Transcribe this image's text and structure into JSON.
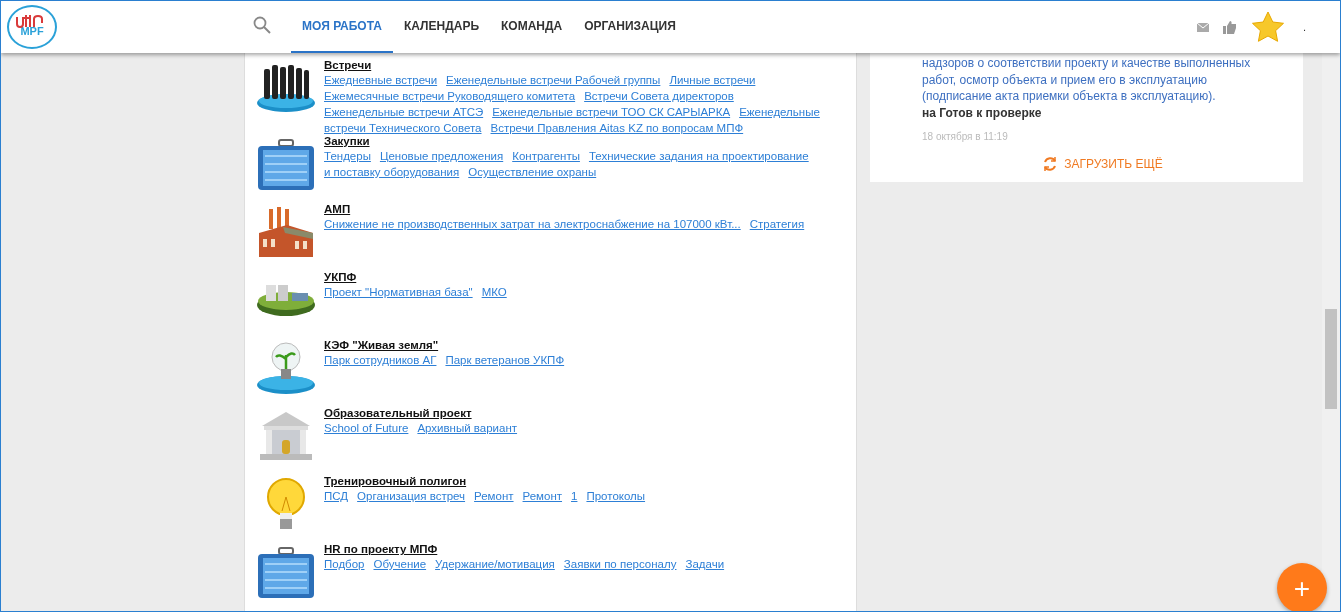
{
  "header": {
    "logo": "MPF",
    "tabs": [
      {
        "label": "МОЯ РАБОТА",
        "selected": true
      },
      {
        "label": "КАЛЕНДАРЬ",
        "selected": false
      },
      {
        "label": "КОМАНДА",
        "selected": false
      },
      {
        "label": "ОРГАНИЗАЦИЯ",
        "selected": false
      }
    ],
    "user_name": "."
  },
  "sections": [
    {
      "title": "Встречи",
      "lines": [
        [
          "Ежедневные встречи",
          "Еженедельные встречи Рабочей группы",
          "Личные встречи"
        ],
        [
          "Ежемесячные встречи Руководящего комитета",
          "Встречи Совета директоров"
        ],
        [
          "Еженедельные встречи АТСЭ",
          "Еженедельные встречи ТОО СК САРЫАРКА",
          "Еженедельные"
        ],
        [
          "встречи Технического Совета",
          "Встречи Правления Aitas KZ по вопросам МПФ"
        ]
      ]
    },
    {
      "title": "Закупки",
      "lines": [
        [
          "Тендеры",
          "Ценовые предложения",
          "Контрагенты",
          "Технические задания на проектирование"
        ],
        [
          "и поставку оборудования",
          "Осуществление охраны"
        ]
      ]
    },
    {
      "title": "АМП",
      "lines": [
        [
          "Снижение не производственных затрат на электроснабжение на 107000 кВт...",
          "Стратегия"
        ]
      ]
    },
    {
      "title": "УКПФ",
      "lines": [
        [
          "Проект \"Нормативная база\"",
          "МКО"
        ]
      ]
    },
    {
      "title": "КЭФ \"Живая земля\"",
      "lines": [
        [
          "Парк сотрудников АГ",
          "Парк ветеранов УКПФ"
        ]
      ]
    },
    {
      "title": "Образовательный проект",
      "lines": [
        [
          "School of Future",
          "Архивный вариант"
        ]
      ]
    },
    {
      "title": "Тренировочный полигон",
      "lines": [
        [
          "ПСД",
          "Организация встреч",
          "Ремонт",
          "Ремонт",
          "1",
          "Протоколы"
        ]
      ]
    },
    {
      "title": "HR по проекту МПФ",
      "lines": [
        [
          "Подбор",
          "Обучение",
          "Удержание/мотивация",
          "Заявки по персоналу",
          "Задачи"
        ]
      ]
    }
  ],
  "feed": {
    "link_lines": [
      "надзоров о соответствии проекту и качестве выполненных",
      "работ, осмотр объекта и прием его в эксплуатацию",
      "(подписание акта приемки объекта в эксплуатацию)."
    ],
    "status": "на Готов к проверке",
    "time": "18 октября в 11:19",
    "load_more": "ЗАГРУЗИТЬ ЕЩЁ"
  },
  "fab": "+"
}
